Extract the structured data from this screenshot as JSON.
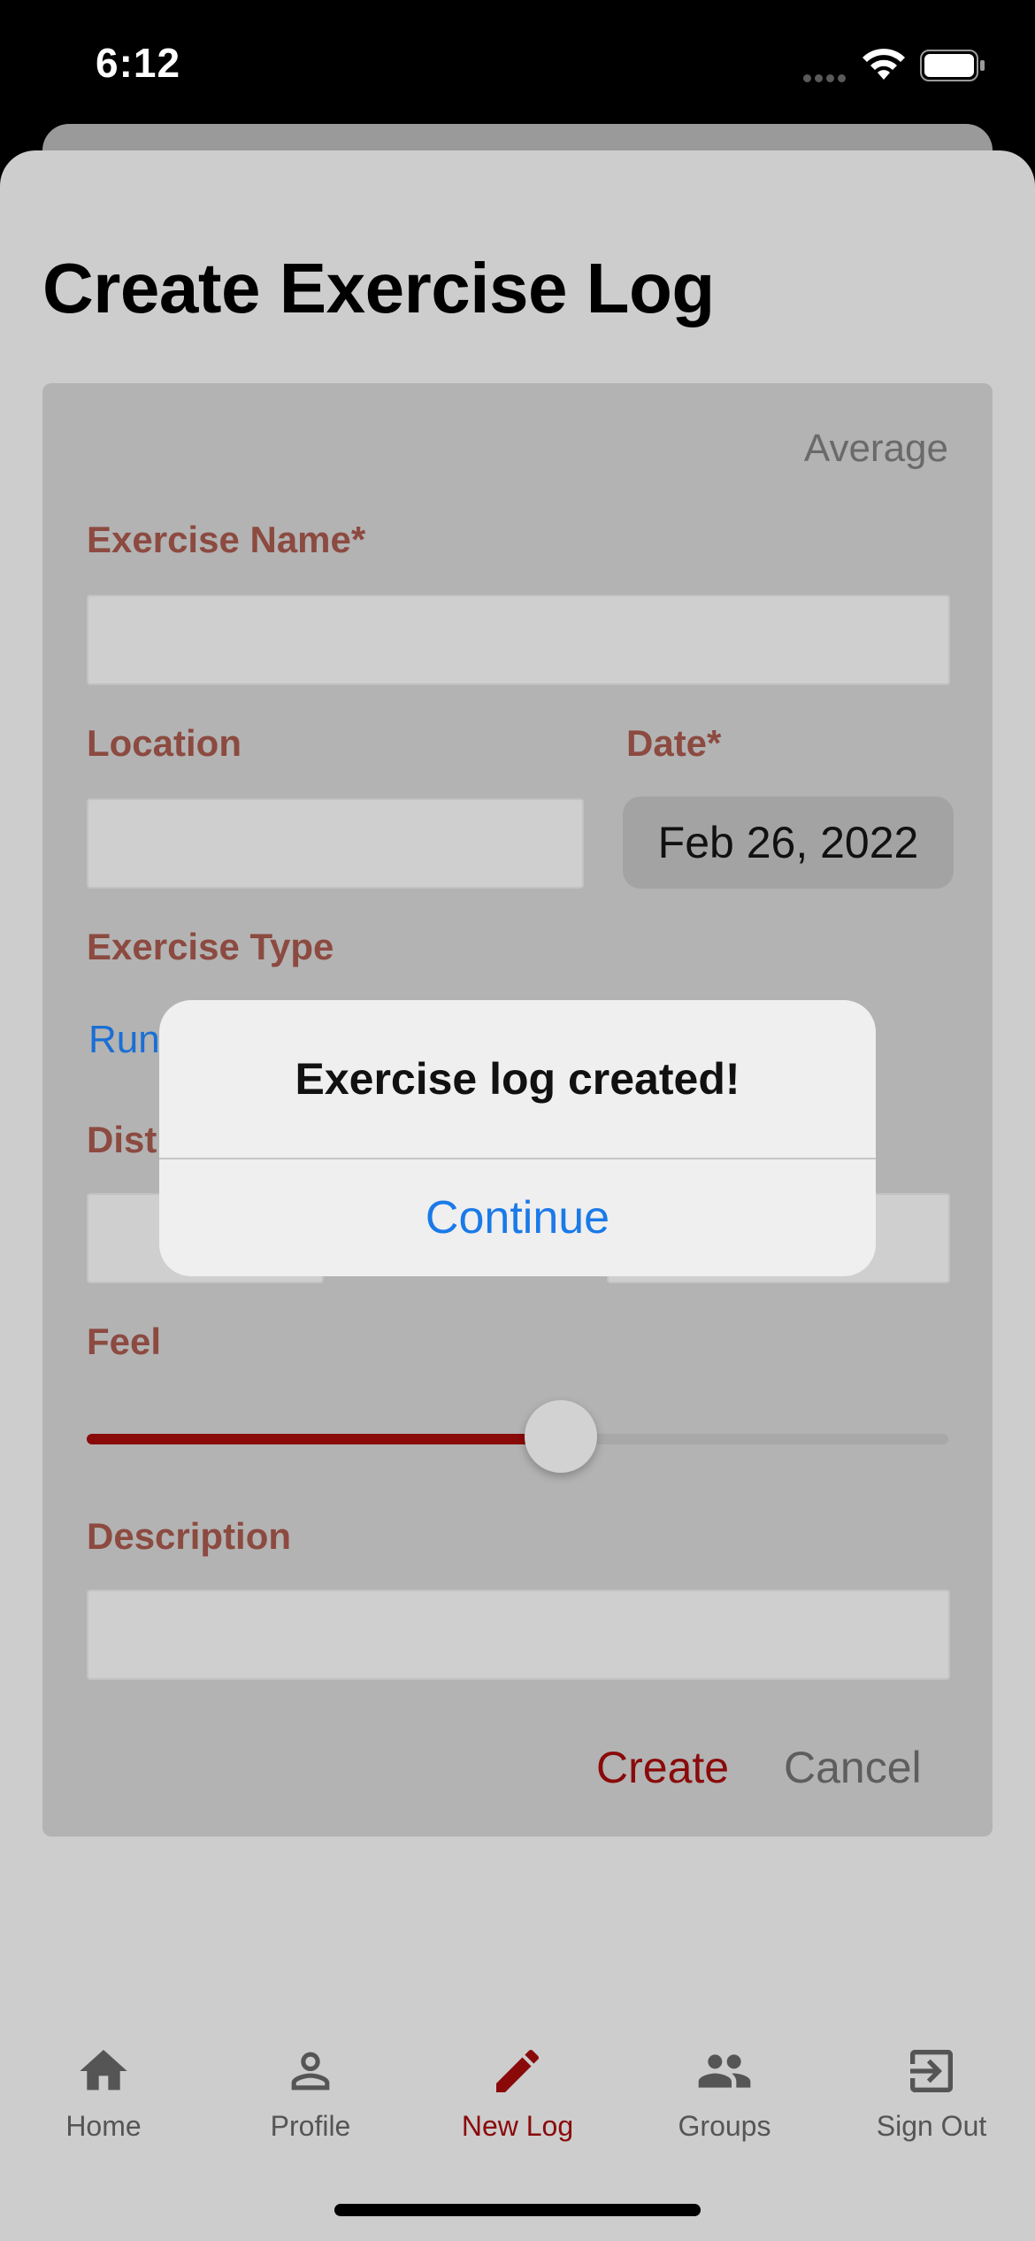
{
  "status_bar": {
    "time": "6:12"
  },
  "page": {
    "title": "Create Exercise Log"
  },
  "form": {
    "feel_value": "Average",
    "exercise_name": {
      "label": "Exercise Name*",
      "value": ""
    },
    "location": {
      "label": "Location",
      "value": ""
    },
    "date": {
      "label": "Date*",
      "value": "Feb 26, 2022"
    },
    "exercise_type": {
      "label": "Exercise Type",
      "selected": "Run"
    },
    "distance": {
      "label": "Dist"
    },
    "feel": {
      "label": "Feel",
      "level": 0.55
    },
    "description": {
      "label": "Description",
      "value": ""
    },
    "create_label": "Create",
    "cancel_label": "Cancel"
  },
  "alert": {
    "title": "Exercise log created!",
    "button_label": "Continue"
  },
  "tabs": [
    {
      "label": "Home",
      "icon": "home-icon",
      "active": false
    },
    {
      "label": "Profile",
      "icon": "person-icon",
      "active": false
    },
    {
      "label": "New Log",
      "icon": "pencil-icon",
      "active": true
    },
    {
      "label": "Groups",
      "icon": "groups-icon",
      "active": false
    },
    {
      "label": "Sign Out",
      "icon": "sign-out-icon",
      "active": false
    }
  ],
  "colors": {
    "accent": "#8a0a0a",
    "label": "#8c4a40",
    "link": "#1a7ae8"
  }
}
